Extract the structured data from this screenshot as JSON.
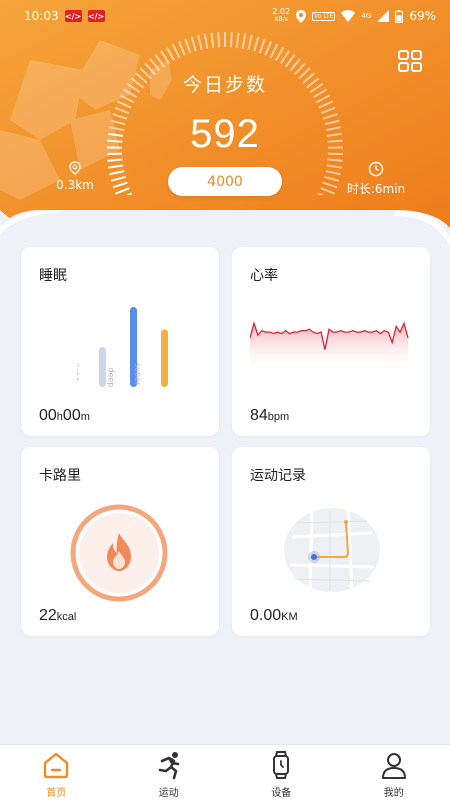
{
  "status_bar": {
    "time": "10:03",
    "net_speed_value": "2.02",
    "net_speed_unit": "KB/s",
    "lte_label": "Vo LTE",
    "network": "4G",
    "battery": "69%"
  },
  "header": {
    "steps_label": "今日步数",
    "steps_value": "592",
    "steps_goal": "4000",
    "steps_progress": 0.148,
    "distance": "0.3km",
    "duration": "时长:6min",
    "accent_start": "#f49a2c",
    "accent_end": "#ef7f1a"
  },
  "cards": {
    "sleep": {
      "title": "睡眠",
      "value_hours": "00",
      "unit_h": "h",
      "value_minutes": "00",
      "unit_m": "m",
      "bars": [
        {
          "label": "light",
          "value": 0.5,
          "color": "#c9d6ee"
        },
        {
          "label": "deep",
          "value": 1.0,
          "color": "#5a8cef"
        },
        {
          "label": "sober",
          "value": 0.72,
          "color": "#f2b23a"
        }
      ]
    },
    "heart": {
      "title": "心率",
      "value": "84",
      "unit": "bpm",
      "line_color": "#d9253b",
      "samples": [
        70,
        80,
        72,
        75,
        74,
        74,
        73,
        74,
        73,
        75,
        73,
        74,
        74,
        75,
        75,
        76,
        74,
        73,
        74,
        62,
        76,
        74,
        74,
        75,
        74,
        74,
        75,
        74,
        74,
        75,
        74,
        74,
        75,
        73,
        75,
        74,
        67,
        78,
        74,
        80,
        70
      ]
    },
    "calorie": {
      "title": "卡路里",
      "value": "22",
      "unit": "kcal",
      "ring_color": "#f4a77c"
    },
    "record": {
      "title": "运动记录",
      "value": "0.00",
      "unit": "KM"
    }
  },
  "nav": {
    "items": [
      {
        "label": "首页",
        "icon": "home-icon",
        "active": true
      },
      {
        "label": "运动",
        "icon": "running-icon",
        "active": false
      },
      {
        "label": "设备",
        "icon": "watch-icon",
        "active": false
      },
      {
        "label": "我的",
        "icon": "user-icon",
        "active": false
      }
    ]
  }
}
